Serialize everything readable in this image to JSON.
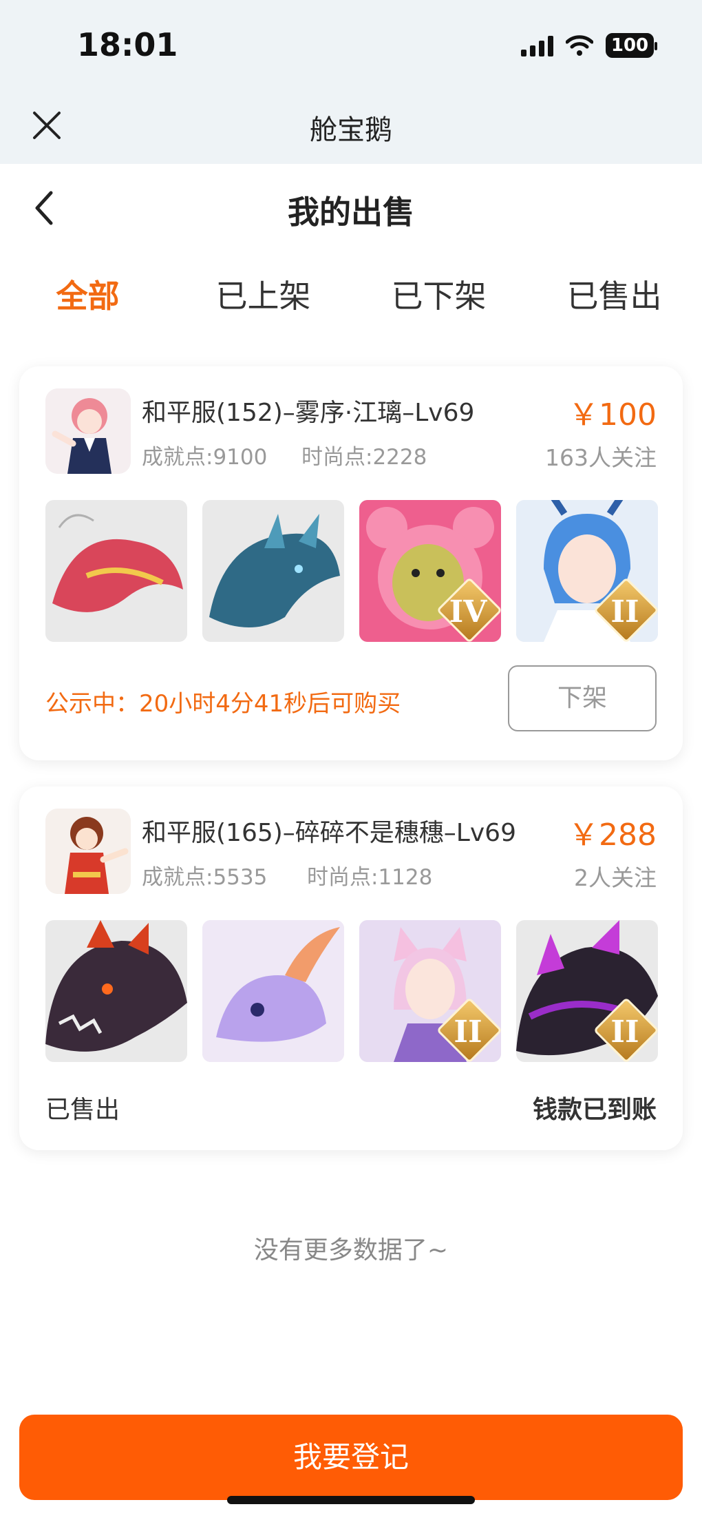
{
  "status_bar": {
    "time": "18:01",
    "battery": "100"
  },
  "miniapp": {
    "title": "舱宝鹅"
  },
  "header": {
    "title": "我的出售"
  },
  "tabs": [
    {
      "label": "全部",
      "active": true
    },
    {
      "label": "已上架",
      "active": false
    },
    {
      "label": "已下架",
      "active": false
    },
    {
      "label": "已售出",
      "active": false
    }
  ],
  "listings": [
    {
      "title": "和平服(152)–雾序·江璃–Lv69",
      "achievement": "成就点:9100",
      "fashion": "时尚点:2228",
      "price": "￥100",
      "followers": "163人关注",
      "thumbs": [
        {
          "icon": "red-dragon-icon",
          "rank": ""
        },
        {
          "icon": "blue-dragon-icon",
          "rank": ""
        },
        {
          "icon": "pink-bear-icon",
          "rank": "IV"
        },
        {
          "icon": "blue-hair-character-icon",
          "rank": "II"
        }
      ],
      "notice": "公示中：20小时4分41秒后可购买",
      "action_label": "下架"
    },
    {
      "title": "和平服(165)–碎碎不是穗穗–Lv69",
      "achievement": "成就点:5535",
      "fashion": "时尚点:1128",
      "price": "￥288",
      "followers": "2人关注",
      "thumbs": [
        {
          "icon": "dark-dragon-icon",
          "rank": ""
        },
        {
          "icon": "lilac-dragon-icon",
          "rank": ""
        },
        {
          "icon": "fox-girl-icon",
          "rank": "II"
        },
        {
          "icon": "purple-dragon-icon",
          "rank": "II"
        }
      ],
      "status": "已售出",
      "payment": "钱款已到账"
    }
  ],
  "footer": {
    "no_more": "没有更多数据了~",
    "cta_label": "我要登记"
  },
  "colors": {
    "accent": "#f26a12",
    "cta": "#ff5c05"
  }
}
